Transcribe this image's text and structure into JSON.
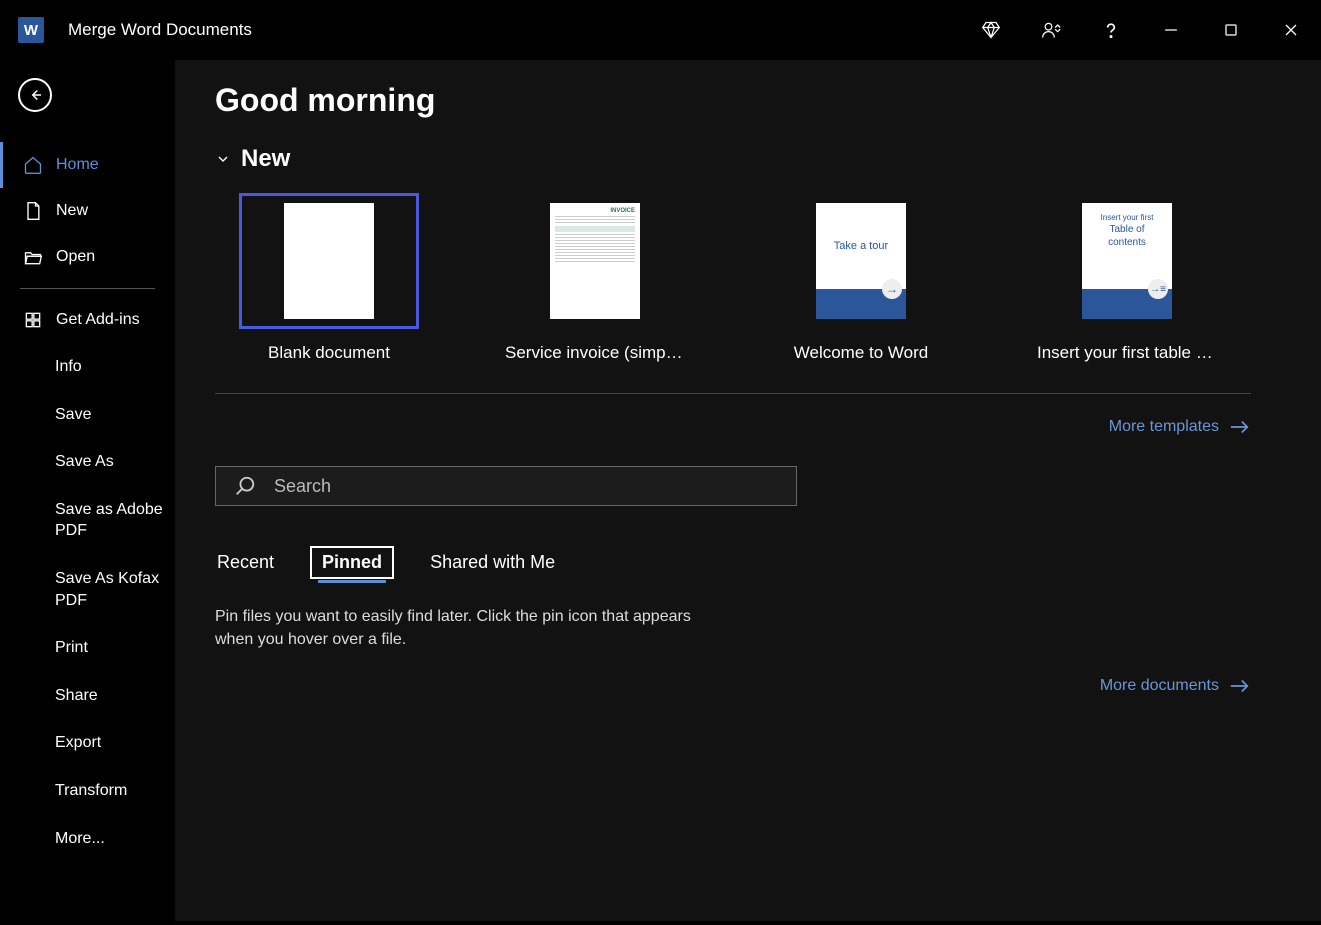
{
  "title": "Merge Word Documents",
  "sidebar": {
    "home": "Home",
    "new": "New",
    "open": "Open",
    "addins": "Get Add-ins",
    "info": "Info",
    "save": "Save",
    "saveas": "Save As",
    "saveadobe": "Save as Adobe PDF",
    "savekofax": "Save As Kofax PDF",
    "print": "Print",
    "share": "Share",
    "export": "Export",
    "transform": "Transform",
    "more": "More..."
  },
  "greeting": "Good morning",
  "newSection": "New",
  "templates": {
    "blank": "Blank document",
    "invoice": "Service invoice (simple line…",
    "welcome": "Welcome to Word",
    "toc": "Insert your first table of con…",
    "invoiceHeader": "INVOICE",
    "tourText": "Take a tour",
    "tocLine1": "Insert your first",
    "tocLine2": "Table of",
    "tocLine3": "contents"
  },
  "moreTemplates": "More templates",
  "searchPlaceholder": "Search",
  "tabs": {
    "recent": "Recent",
    "pinned": "Pinned",
    "shared": "Shared with Me"
  },
  "pinMessage": "Pin files you want to easily find later. Click the pin icon that appears when you hover over a file.",
  "moreDocuments": "More documents"
}
